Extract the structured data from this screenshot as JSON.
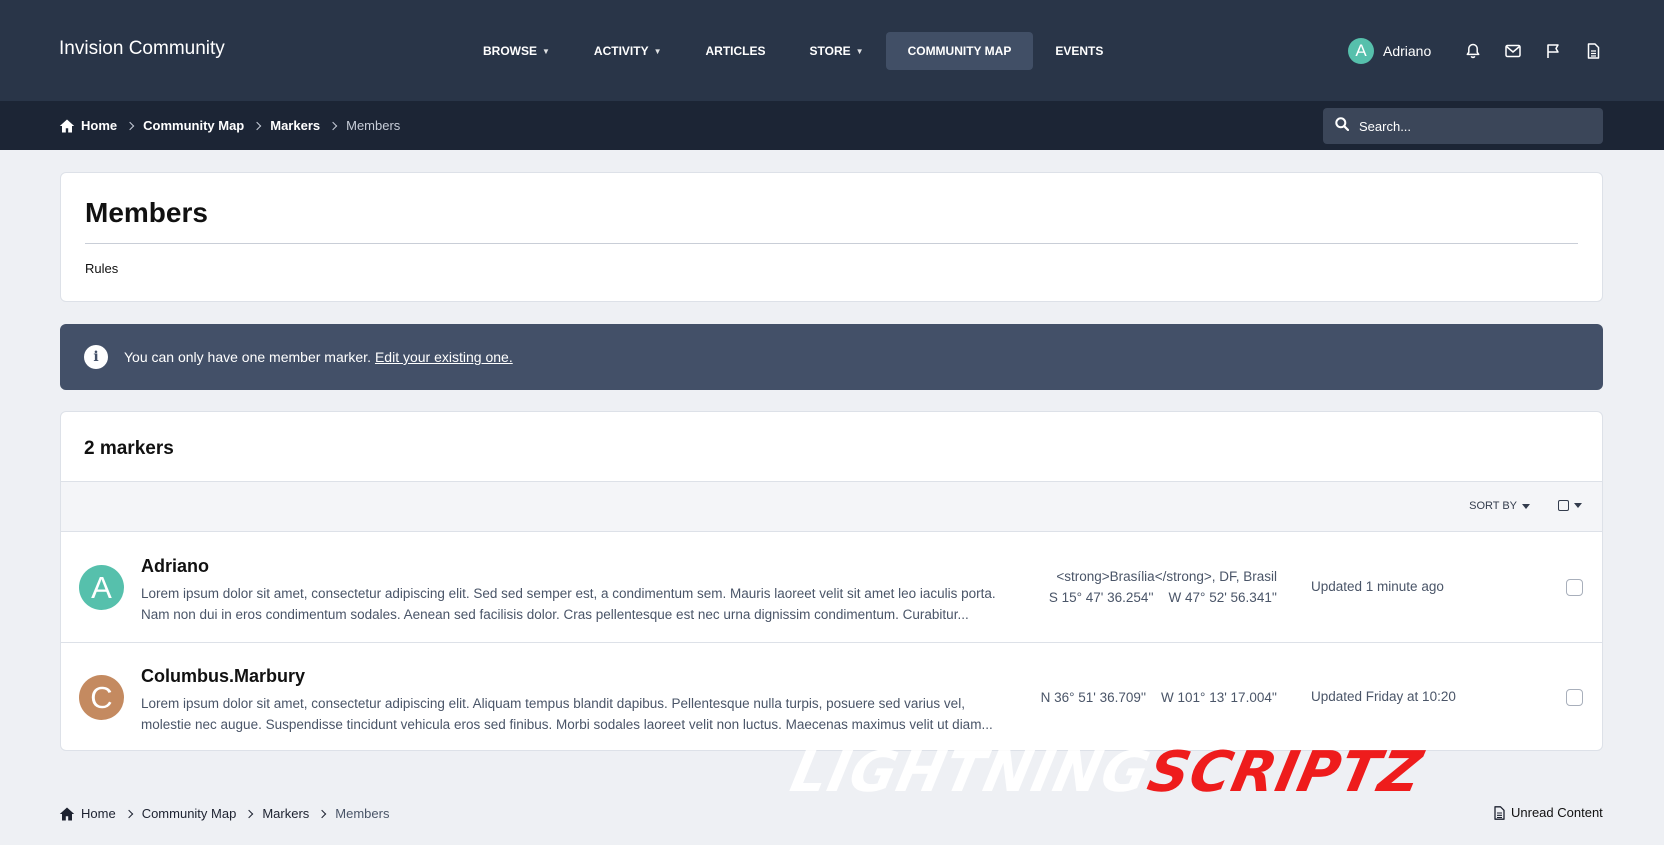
{
  "header": {
    "site_title": "Invision Community",
    "nav": [
      {
        "label": "Browse",
        "has_caret": true
      },
      {
        "label": "Activity",
        "has_caret": true
      },
      {
        "label": "Articles",
        "has_caret": false
      },
      {
        "label": "Store",
        "has_caret": true
      },
      {
        "label": "Community Map",
        "has_caret": false,
        "active": true
      },
      {
        "label": "Events",
        "has_caret": false
      }
    ],
    "user": {
      "initial": "A",
      "name": "Adriano",
      "avatar_color": "#56c0ac"
    },
    "icons": [
      "bell-icon",
      "envelope-icon",
      "flag-icon",
      "document-icon"
    ]
  },
  "breadcrumb": {
    "items": [
      "Home",
      "Community Map",
      "Markers",
      "Members"
    ]
  },
  "search": {
    "placeholder": "Search..."
  },
  "page": {
    "title": "Members",
    "rules_label": "Rules"
  },
  "info_message": {
    "text": "You can only have one member marker.",
    "link": "Edit your existing one."
  },
  "markers": {
    "count_label": "2 markers",
    "sort_label": "Sort By",
    "rows": [
      {
        "initial": "A",
        "avatar_color": "#56c0ac",
        "name": "Adriano",
        "desc_line1": "Lorem ipsum dolor sit amet, consectetur adipiscing elit. Sed sed semper est, a condimentum sem. Mauris laoreet velit sit amet leo iaculis porta.",
        "desc_line2": "Nam non dui in eros condimentum sodales. Aenean sed facilisis dolor. Cras pellentesque est nec urna dignissim condimentum. Curabitur...",
        "location": "<strong>Brasília</strong>, DF, Brasil",
        "coords": "S 15° 47' 36.254''    W 47° 52' 56.341''",
        "updated": "Updated 1 minute ago"
      },
      {
        "initial": "C",
        "avatar_color": "#c48a60",
        "name": "Columbus.Marbury",
        "desc_line1": "Lorem ipsum dolor sit amet, consectetur adipiscing elit. Aliquam tempus blandit dapibus. Pellentesque nulla turpis, posuere sed varius vel,",
        "desc_line2": "molestie nec augue. Suspendisse tincidunt vehicula eros sed finibus. Morbi sodales laoreet velit non luctus. Maecenas maximus velit ut diam...",
        "coords": "N 36° 51' 36.709''    W 101° 13' 17.004''",
        "updated": "Updated Friday at 10:20"
      }
    ]
  },
  "watermark": {
    "part1": "LIGHTNING",
    "part2": "SCRIPTZ"
  },
  "footer": {
    "unread_label": "Unread Content"
  },
  "colors": {
    "header_bg": "#293548",
    "crumb_bg": "#1c2535",
    "info_bg": "#435068",
    "accent": "#56c0ac"
  }
}
